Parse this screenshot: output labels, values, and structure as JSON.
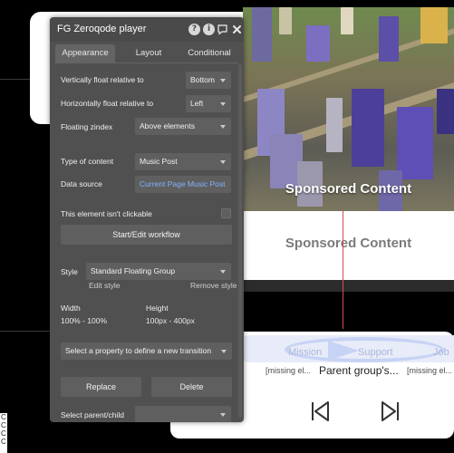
{
  "panel": {
    "title": "FG Zeroqode player",
    "tabs": [
      {
        "label": "Appearance",
        "active": true
      },
      {
        "label": "Layout",
        "active": false
      },
      {
        "label": "Conditional",
        "active": false
      }
    ],
    "icons": [
      "help-icon",
      "info-icon",
      "comment-icon",
      "close-icon"
    ],
    "fields": {
      "vertical_float": {
        "label": "Vertically float relative to",
        "value": "Bottom"
      },
      "horizontal_float": {
        "label": "Horizontally float relative to",
        "value": "Left"
      },
      "floating_zindex": {
        "label": "Floating zindex",
        "value": "Above elements"
      },
      "type_of_content": {
        "label": "Type of content",
        "value": "Music Post"
      },
      "data_source": {
        "label": "Data source",
        "value": "Current Page Music Post"
      },
      "not_clickable": {
        "label": "This element isn't clickable"
      },
      "style": {
        "label": "Style",
        "value": "Standard Floating Group",
        "edit": "Edit style",
        "remove": "Remove style"
      },
      "width": {
        "label": "Width",
        "value": "100% - 100%"
      },
      "height": {
        "label": "Height",
        "value": "100px - 400px"
      },
      "transition": {
        "placeholder": "Select a property to define a new transition"
      },
      "select_parent": {
        "label": "Select parent/child"
      }
    },
    "buttons": {
      "workflow": "Start/Edit workflow",
      "replace": "Replace",
      "delete": "Delete"
    }
  },
  "canvas": {
    "sponsored_overlay": "Sponsored Content",
    "sponsored_card": "Sponsored Content",
    "player": {
      "tabs": [
        "Mission",
        "Support",
        "Job"
      ],
      "missing_left": "[missing el...",
      "missing_right": "[missing el...",
      "group_text": "Parent group's...",
      "left_strip": [
        "C",
        "C",
        "C",
        "C"
      ]
    }
  },
  "colors": {
    "panel_bg": "#505050",
    "link_blue": "#7fb4ff",
    "redline": "#d94b4b"
  }
}
